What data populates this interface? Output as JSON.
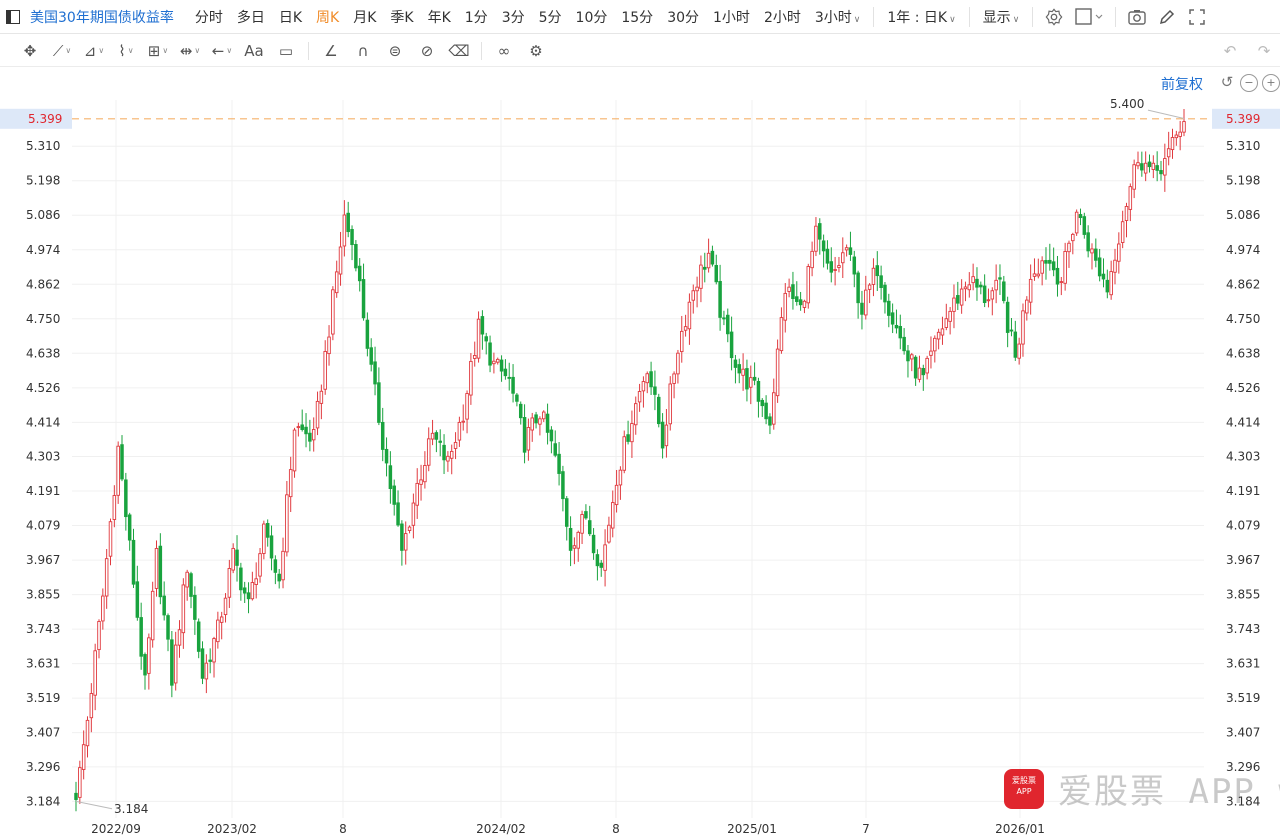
{
  "toolbar": {
    "symbol": "美国30年期国债收益率",
    "timeframes": [
      "分时",
      "多日",
      "日K",
      "周K",
      "月K",
      "季K",
      "年K",
      "1分",
      "3分",
      "5分",
      "10分",
      "15分",
      "30分",
      "1小时",
      "2小时"
    ],
    "active_timeframe": "周K",
    "three_hour": "3小时",
    "range_label": "1年 : 日K",
    "display_label": "显示"
  },
  "draw_tools": [
    "move-icon",
    "trendline-icon",
    "channel-icon",
    "wave-icon",
    "fib-icon",
    "measure-icon",
    "arrow-icon",
    "text-icon",
    "note-icon",
    "brush-icon",
    "magnet-icon",
    "lock-icon",
    "hide-icon",
    "trash-icon",
    "link-icon",
    "settings-icon"
  ],
  "draw_text_tool": "Aa",
  "adjust_label": "前复权",
  "colors": {
    "up": "#e0393e",
    "down": "#19a33e",
    "price_line": "#f5b26b",
    "current": "#e0262e",
    "accent": "#1f6fd1"
  },
  "watermark": {
    "text": "爱股票 APP www.aigupiao.com"
  },
  "chart_data": {
    "type": "candlestick",
    "title": "美国30年期国债收益率",
    "y_ticks": [
      3.184,
      3.296,
      3.407,
      3.519,
      3.631,
      3.743,
      3.855,
      3.967,
      4.079,
      4.191,
      4.303,
      4.414,
      4.526,
      4.638,
      4.75,
      4.862,
      4.974,
      5.086,
      5.198,
      5.31,
      5.399
    ],
    "ylim": [
      3.13,
      5.46
    ],
    "x_ticks": [
      "2022/09",
      "2023/02",
      "8",
      "2024/02",
      "8",
      "2025/01",
      "7",
      "2026/01"
    ],
    "current_value": "5.399",
    "max_label": "5.400",
    "min_label": "3.184",
    "anchors": [
      [
        0,
        3.19
      ],
      [
        3,
        3.45
      ],
      [
        7,
        3.85
      ],
      [
        11,
        4.33
      ],
      [
        15,
        3.9
      ],
      [
        18,
        3.56
      ],
      [
        21,
        3.98
      ],
      [
        25,
        3.58
      ],
      [
        29,
        3.95
      ],
      [
        33,
        3.59
      ],
      [
        37,
        3.74
      ],
      [
        41,
        3.98
      ],
      [
        45,
        3.82
      ],
      [
        49,
        4.05
      ],
      [
        53,
        3.9
      ],
      [
        57,
        4.4
      ],
      [
        62,
        4.36
      ],
      [
        66,
        4.72
      ],
      [
        70,
        5.08
      ],
      [
        73,
        4.95
      ],
      [
        77,
        4.58
      ],
      [
        81,
        4.28
      ],
      [
        85,
        3.99
      ],
      [
        89,
        4.21
      ],
      [
        93,
        4.37
      ],
      [
        97,
        4.28
      ],
      [
        101,
        4.45
      ],
      [
        105,
        4.72
      ],
      [
        109,
        4.6
      ],
      [
        113,
        4.55
      ],
      [
        117,
        4.35
      ],
      [
        121,
        4.45
      ],
      [
        125,
        4.3
      ],
      [
        129,
        4.02
      ],
      [
        133,
        4.11
      ],
      [
        137,
        3.94
      ],
      [
        141,
        4.24
      ],
      [
        145,
        4.43
      ],
      [
        149,
        4.6
      ],
      [
        153,
        4.35
      ],
      [
        157,
        4.66
      ],
      [
        161,
        4.85
      ],
      [
        165,
        4.96
      ],
      [
        169,
        4.72
      ],
      [
        173,
        4.58
      ],
      [
        177,
        4.52
      ],
      [
        181,
        4.42
      ],
      [
        185,
        4.85
      ],
      [
        189,
        4.78
      ],
      [
        193,
        5.02
      ],
      [
        197,
        4.88
      ],
      [
        201,
        4.98
      ],
      [
        205,
        4.78
      ],
      [
        209,
        4.92
      ],
      [
        213,
        4.75
      ],
      [
        217,
        4.62
      ],
      [
        221,
        4.55
      ],
      [
        225,
        4.7
      ],
      [
        229,
        4.8
      ],
      [
        233,
        4.88
      ],
      [
        237,
        4.82
      ],
      [
        241,
        4.85
      ],
      [
        245,
        4.62
      ],
      [
        249,
        4.9
      ],
      [
        253,
        4.95
      ],
      [
        257,
        4.88
      ],
      [
        261,
        5.1
      ],
      [
        265,
        4.96
      ],
      [
        269,
        4.85
      ],
      [
        273,
        5.08
      ],
      [
        277,
        5.28
      ],
      [
        281,
        5.22
      ],
      [
        285,
        5.28
      ],
      [
        289,
        5.4
      ]
    ],
    "num_candles": 290
  }
}
